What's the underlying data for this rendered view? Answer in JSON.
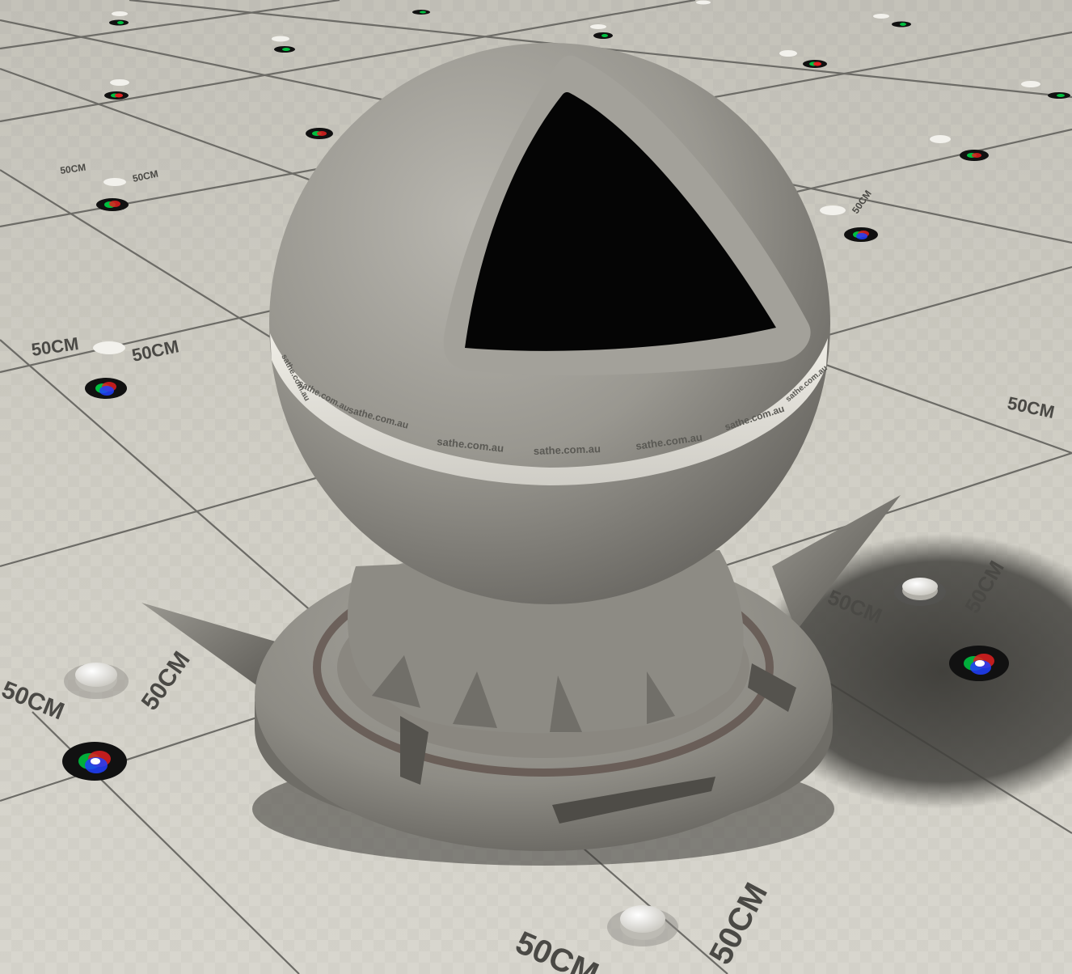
{
  "floor": {
    "tile_label": "50CM",
    "colors": {
      "floor": "#d3d1c8",
      "floor_far": "#c9c7be",
      "grid_line": "#6c6b66",
      "label": "#4a4945"
    }
  },
  "band": {
    "text": "sathe.com.au",
    "colors": {
      "band": "#e4e2db",
      "band_text": "#5a5954"
    }
  },
  "material": {
    "colors": {
      "concrete_light": "#b5b3ac",
      "concrete_mid": "#8f8d86",
      "concrete_dark": "#5e5c57",
      "cutout": "#050505",
      "shadow": "#3f3e3a"
    }
  },
  "icons": {
    "color_wheel": "rgb-color-wheel-icon",
    "white_disc": "white-puck-icon"
  }
}
